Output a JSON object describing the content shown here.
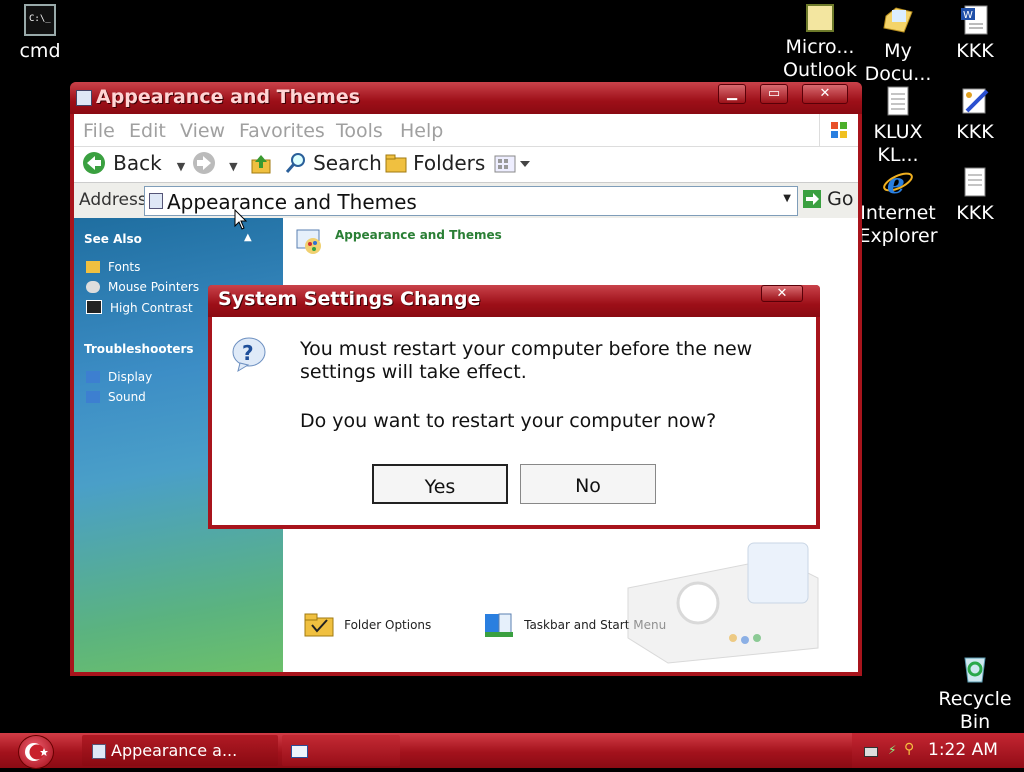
{
  "desktop": {
    "icons": [
      {
        "label": "cmd"
      },
      {
        "label": "Micro... Outlook"
      },
      {
        "label": "My Docu..."
      },
      {
        "label": "KKK"
      },
      {
        "label": "KLUX KL..."
      },
      {
        "label": "KKK"
      },
      {
        "label": "Internet Explorer"
      },
      {
        "label": "KKK"
      },
      {
        "label": "Recycle Bin"
      }
    ]
  },
  "window": {
    "title": "Appearance and Themes",
    "menu": [
      "File",
      "Edit",
      "View",
      "Favorites",
      "Tools",
      "Help"
    ],
    "toolbar": {
      "back": "Back",
      "search": "Search",
      "folders": "Folders"
    },
    "address": {
      "label": "Address",
      "value": "Appearance and Themes",
      "go": "Go"
    },
    "left_pane": {
      "see_also": {
        "heading": "See Also",
        "items": [
          "Fonts",
          "Mouse Pointers",
          "High Contrast"
        ]
      },
      "troubleshooters": {
        "heading": "Troubleshooters",
        "items": [
          "Display",
          "Sound"
        ]
      }
    },
    "content": {
      "header": "Appearance and Themes",
      "tasks": [
        "Folder Options",
        "Taskbar and Start Menu"
      ]
    }
  },
  "dialog": {
    "title": "System Settings Change",
    "message1": "You must restart your computer before the new settings will take effect.",
    "message2": "Do you want to restart your computer now?",
    "yes": "Yes",
    "no": "No"
  },
  "taskbar": {
    "task_label": "Appearance a...",
    "clock": "1:22 AM"
  },
  "colors": {
    "accent": "#a8141c",
    "pane_top": "#1f6ea0",
    "pane_bottom": "#6cc06a"
  }
}
